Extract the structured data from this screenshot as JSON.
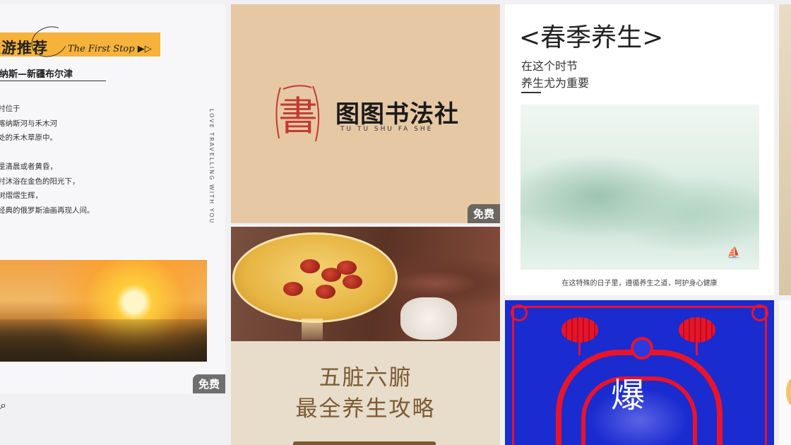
{
  "free_badge": "免费",
  "cards": {
    "travel": {
      "title": "旅游推荐",
      "script": "The First Stop ▶▷",
      "subtitle": "喀纳斯—新疆布尔津",
      "para1": "禾木村位于\n新疆喀纳斯河与禾木河\n交汇处的禾木草原中。",
      "para2": "无论是清晨或者黄昏，\n禾木村沐浴在金色的阳光下，\n白桦树熠熠生辉，\n如同经典的俄罗斯油画再现人间。",
      "vertical": "LOVE TRAVELLING WITH YOU"
    },
    "calligraphy": {
      "seal_char": "書",
      "brand": "图图书法社",
      "pinyin": "TU TU SHU FA SHE"
    },
    "health_food": {
      "line1": "五脏六腑",
      "line2": "最全养生攻略"
    },
    "spring": {
      "heading": "<春季养生>",
      "line1": "在这个时节",
      "line2": "养生尤为重要",
      "caption": "在这特殊的日子里，遵循养生之道，呵护身心健康"
    },
    "festival": {
      "char": "爆"
    }
  },
  "search": {
    "icon": "search-icon"
  },
  "colors": {
    "travel_accent": "#f6b23a",
    "calligraphy_bg": "#e6c8a4",
    "festival_blue": "#1a2bd0",
    "festival_red": "#e8142a",
    "health_text": "#7a5a32"
  }
}
